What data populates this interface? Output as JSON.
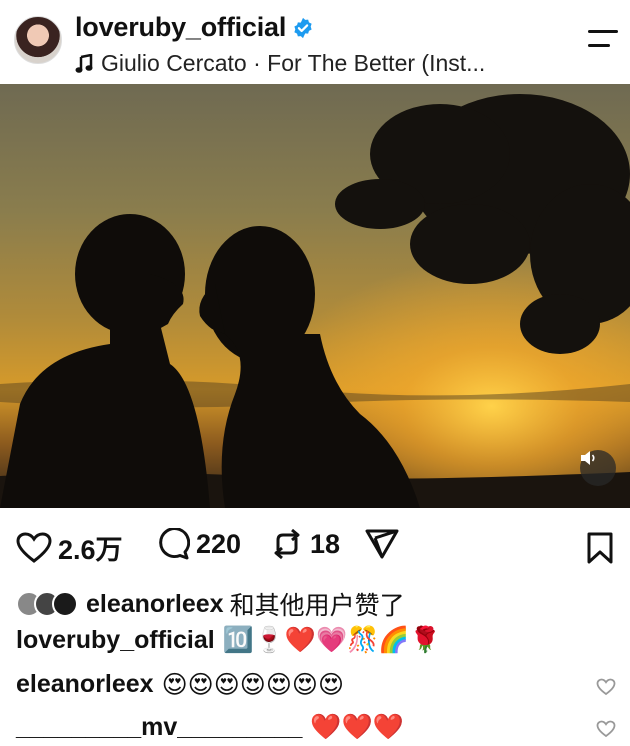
{
  "post": {
    "username": "loveruby_official",
    "music_text": "Giulio Cercato · For The Better (Inst...",
    "likes": "2.6万",
    "comments": "220",
    "reposts": "18"
  },
  "liked_by": {
    "user": "eleanorleex",
    "suffix": "和其他用户赞了"
  },
  "caption": {
    "user": "loveruby_official",
    "emojis": "🔟🍷❤️💗🎊🌈🌹"
  },
  "comments": [
    {
      "user": "eleanorleex",
      "text": "😍😍😍😍😍😍😍"
    },
    {
      "user": "_________mv_________",
      "text": "❤️❤️❤️"
    }
  ],
  "colors": {
    "accent_verified": "#1d9bf0",
    "text": "#111111"
  },
  "icons": [
    "verified-icon",
    "music-note-icon",
    "menu-icon",
    "mute-icon",
    "heart-icon",
    "comment-icon",
    "repost-icon",
    "send-icon",
    "bookmark-icon"
  ]
}
